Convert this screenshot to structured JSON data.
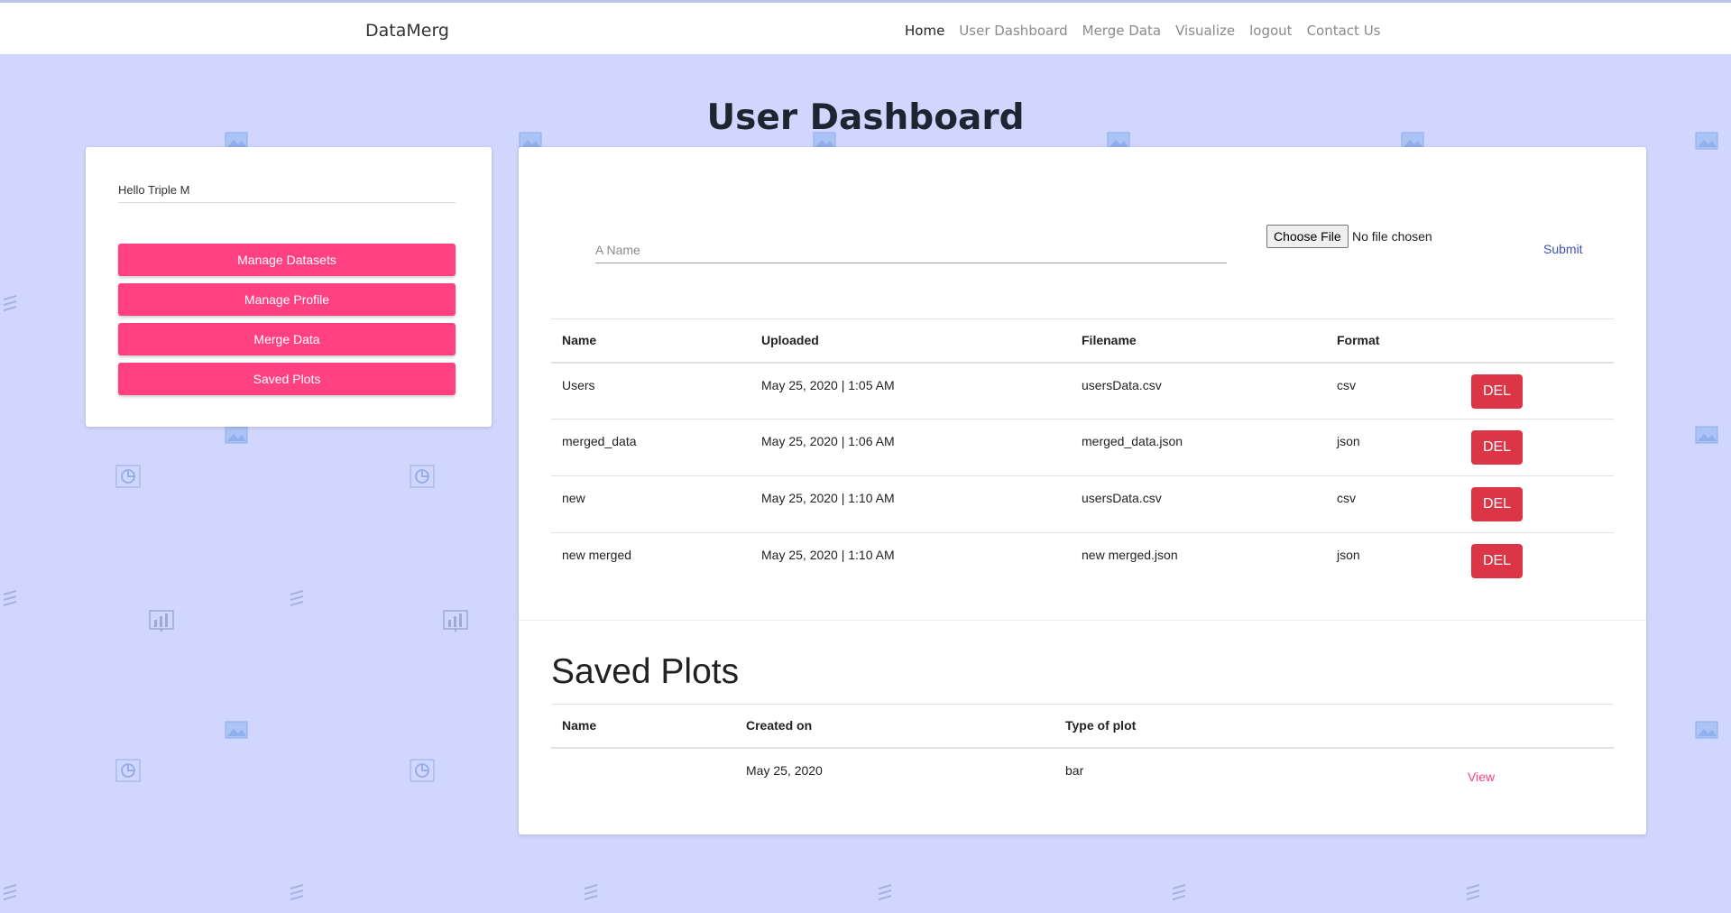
{
  "nav": {
    "brand": "DataMerg",
    "links": [
      "Home",
      "User Dashboard",
      "Merge Data",
      "Visualize",
      "logout",
      "Contact Us"
    ]
  },
  "page_title": "User Dashboard",
  "sidebar": {
    "greeting": "Hello Triple M",
    "buttons": [
      "Manage Datasets",
      "Manage Profile",
      "Merge Data",
      "Saved Plots"
    ]
  },
  "upload": {
    "name_placeholder": "A Name",
    "file_button": "Choose File",
    "file_status": "No file chosen",
    "submit": "Submit"
  },
  "datasets": {
    "headers": [
      "Name",
      "Uploaded",
      "Filename",
      "Format"
    ],
    "rows": [
      {
        "name": "Users",
        "uploaded": "May 25, 2020 | 1:05 AM",
        "filename": "usersData.csv",
        "format": "csv",
        "action": "DEL"
      },
      {
        "name": "merged_data",
        "uploaded": "May 25, 2020 | 1:06 AM",
        "filename": "merged_data.json",
        "format": "json",
        "action": "DEL"
      },
      {
        "name": "new",
        "uploaded": "May 25, 2020 | 1:10 AM",
        "filename": "usersData.csv",
        "format": "csv",
        "action": "DEL"
      },
      {
        "name": "new merged",
        "uploaded": "May 25, 2020 | 1:10 AM",
        "filename": "new merged.json",
        "format": "json",
        "action": "DEL"
      }
    ]
  },
  "saved_plots": {
    "title": "Saved Plots",
    "headers": [
      "Name",
      "Created on",
      "Type of plot"
    ],
    "rows": [
      {
        "name": "",
        "created_on": "May 25, 2020",
        "type": "bar",
        "action": "View"
      }
    ]
  },
  "colors": {
    "background": "#d0d6fd",
    "accent_pink": "#ff4081",
    "danger_red": "#dc3545",
    "link_blue": "#3f51b5"
  },
  "background_icons": [
    "image-icon",
    "pie-chart-icon",
    "bar-chart-icon",
    "list-icon"
  ]
}
